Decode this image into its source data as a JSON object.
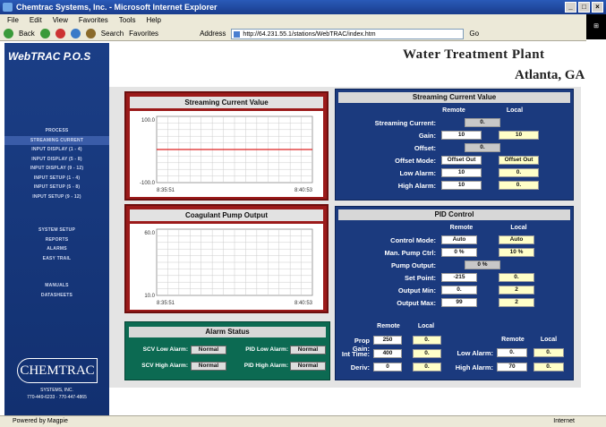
{
  "window": {
    "title": "Chemtrac Systems, Inc. - Microsoft Internet Explorer"
  },
  "menu": [
    "File",
    "Edit",
    "View",
    "Favorites",
    "Tools",
    "Help"
  ],
  "toolbar": {
    "back": "Back",
    "search": "Search",
    "favorites": "Favorites",
    "address_label": "Address",
    "address": "http://64.231.55.1/stations/WebTRAC/index.htm",
    "go": "Go"
  },
  "sidebar": {
    "brand": "WebTRAC P.O.S",
    "nav1": [
      "PROCESS",
      "STREAMING CURRENT",
      "INPUT DISPLAY (1 - 4)",
      "INPUT DISPLAY (5 - 8)",
      "INPUT DISPLAY (9 - 12)",
      "INPUT SETUP (1 - 4)",
      "INPUT SETUP (5 - 8)",
      "INPUT SETUP (9 - 12)"
    ],
    "nav2": [
      "SYSTEM SETUP",
      "REPORTS",
      "ALARMS",
      "EASY TRAIL"
    ],
    "nav3": [
      "MANUALS",
      "DATASHEETS"
    ],
    "logo": "CHEMTRAC",
    "logo_sub1": "SYSTEMS, INC.",
    "logo_sub2": "770-449-6233 · 770-447-4865"
  },
  "header": {
    "line1": "Water Treatment Plant",
    "line2": "Atlanta, GA"
  },
  "chart1": {
    "title": "Streaming Current Value",
    "ymax": "100.0",
    "ymin": "-100.0",
    "tstart": "8:35:51",
    "tend": "8:40:53",
    "trend_level": 0
  },
  "chart2": {
    "title": "Coagulant Pump Output",
    "ymax": "60.0",
    "ymin": "10.0",
    "tstart": "8:35:51",
    "tend": "8:40:53"
  },
  "sc_panel": {
    "title": "Streaming Current Value",
    "remote": "Remote",
    "local": "Local",
    "rows": [
      {
        "label": "Streaming Current:",
        "remote": "",
        "local": "",
        "single": "0."
      },
      {
        "label": "Gain:",
        "remote": "10",
        "local": "10"
      },
      {
        "label": "Offset:",
        "single": "0."
      },
      {
        "label": "Offset Mode:",
        "remote": "Offset Out",
        "local": "Offset Out"
      },
      {
        "label": "Low Alarm:",
        "remote": "10",
        "local": "0."
      },
      {
        "label": "High Alarm:",
        "remote": "10",
        "local": "0."
      }
    ]
  },
  "pid_panel": {
    "title": "PID Control",
    "remote": "Remote",
    "local": "Local",
    "rows": [
      {
        "label": "Control Mode:",
        "remote": "Auto",
        "local": "Auto"
      },
      {
        "label": "Man. Pump Ctrl:",
        "remote": "0 %",
        "local": "10 %"
      },
      {
        "label": "Pump Output:",
        "single": "0 %"
      },
      {
        "label": "Set Point:",
        "remote": "-215",
        "local": "0."
      },
      {
        "label": "Output Min:",
        "remote": "0.",
        "local": "2"
      },
      {
        "label": "Output Max:",
        "remote": "99",
        "local": "2"
      }
    ],
    "tune": {
      "remote": "Remote",
      "local": "Local",
      "rows": [
        {
          "label": "Prop Gain:",
          "remote": "250",
          "local": "0."
        },
        {
          "label": "Int Time:",
          "remote": "400",
          "local": "0."
        },
        {
          "label": "Deriv:",
          "remote": "0",
          "local": "0."
        }
      ]
    },
    "alarms": {
      "remote": "Remote",
      "local": "Local",
      "rows": [
        {
          "label": "Low Alarm:",
          "remote": "0.",
          "local": "0."
        },
        {
          "label": "High Alarm:",
          "remote": "70",
          "local": "0."
        }
      ]
    }
  },
  "alarm_status": {
    "title": "Alarm Status",
    "items": [
      {
        "label": "SCV Low Alarm:",
        "value": "Normal"
      },
      {
        "label": "PID Low Alarm:",
        "value": "Normal"
      },
      {
        "label": "SCV High Alarm:",
        "value": "Normal"
      },
      {
        "label": "PID High Alarm:",
        "value": "Normal"
      }
    ]
  },
  "status": {
    "left": "Powered by Magpie",
    "right": "Internet"
  }
}
